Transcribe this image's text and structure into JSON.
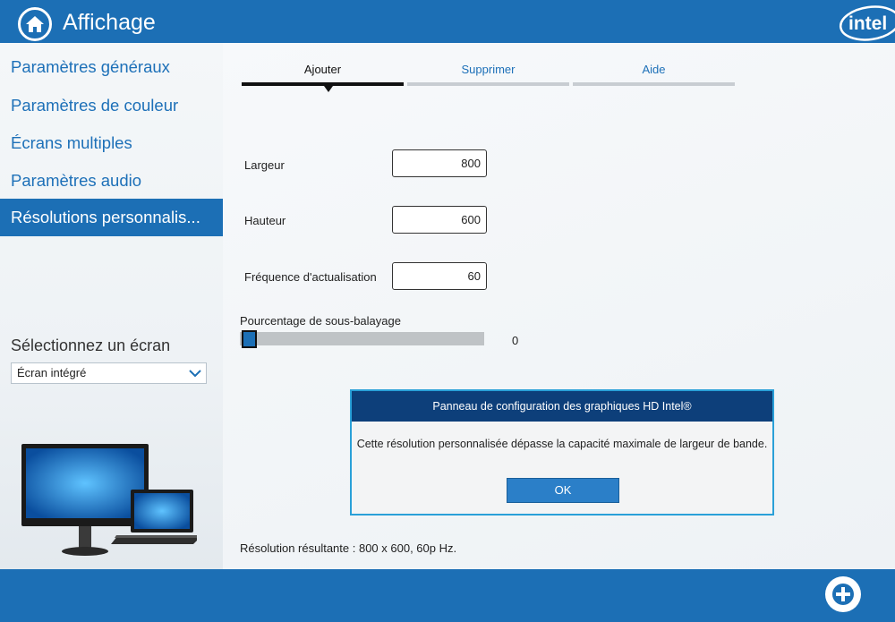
{
  "header": {
    "title": "Affichage",
    "logo_text": "intel",
    "home_icon": "home-icon"
  },
  "sidebar": {
    "items": [
      {
        "label": "Paramètres généraux",
        "active": false
      },
      {
        "label": "Paramètres de couleur",
        "active": false
      },
      {
        "label": "Écrans multiples",
        "active": false
      },
      {
        "label": "Paramètres audio",
        "active": false
      },
      {
        "label": "Résolutions personnalis...",
        "active": true
      }
    ],
    "select_label": "Sélectionnez un écran",
    "select_value": "Écran intégré"
  },
  "tabs": [
    {
      "label": "Ajouter",
      "active": true
    },
    {
      "label": "Supprimer",
      "active": false
    },
    {
      "label": "Aide",
      "active": false
    }
  ],
  "form": {
    "width_label": "Largeur",
    "width_value": "800",
    "height_label": "Hauteur",
    "height_value": "600",
    "refresh_label": "Fréquence d'actualisation",
    "refresh_value": "60"
  },
  "slider": {
    "label": "Pourcentage de sous-balayage",
    "value": "0"
  },
  "dialog": {
    "title": "Panneau de configuration des graphiques HD Intel®",
    "message": "Cette résolution personnalisée dépasse la capacité maximale de largeur de bande.",
    "ok_label": "OK"
  },
  "result_text": "Résolution résultante :  800 x 600, 60p Hz.",
  "colors": {
    "brand": "#1c6fb5",
    "dialog_title": "#0d3f7a",
    "dialog_border": "#2aa0d8"
  }
}
